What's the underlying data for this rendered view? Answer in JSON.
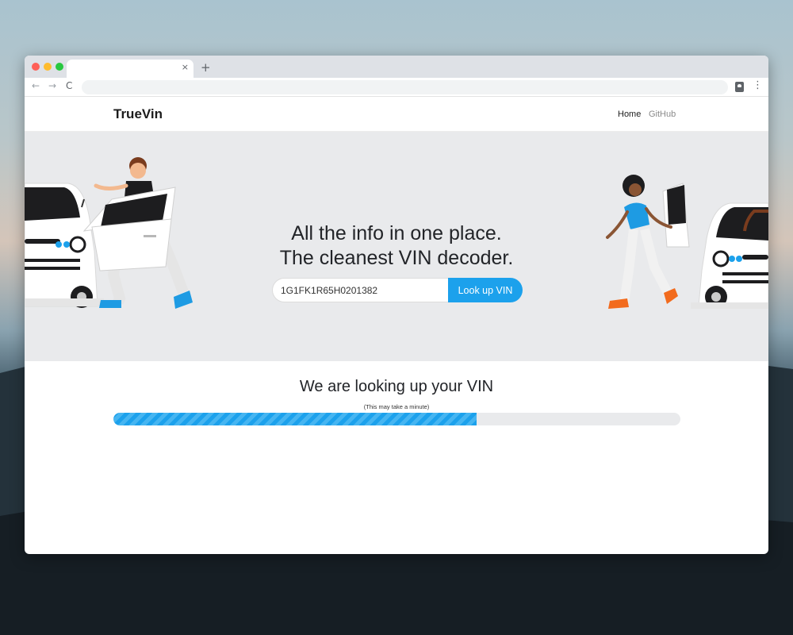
{
  "browser": {
    "tab_close": "×",
    "new_tab": "+",
    "back": "←",
    "forward": "→",
    "reload": "C",
    "menu": "⋮"
  },
  "site": {
    "brand": "TrueVin",
    "nav": {
      "home": "Home",
      "github": "GitHub"
    }
  },
  "hero": {
    "title_line1": "All the info in one place.",
    "title_line2": "The cleanest VIN decoder.",
    "vin_value": "1G1FK1R65H0201382",
    "button_label": "Look up VIN"
  },
  "status": {
    "title": "We are looking up your VIN",
    "subtitle": "(This may take a minute)",
    "progress_fraction": 0.64
  },
  "colors": {
    "accent": "#1ca1ec",
    "hero_bg": "#e9eaec",
    "shoe_blue": "#1e9be3",
    "shoe_orange": "#f26b1d"
  }
}
